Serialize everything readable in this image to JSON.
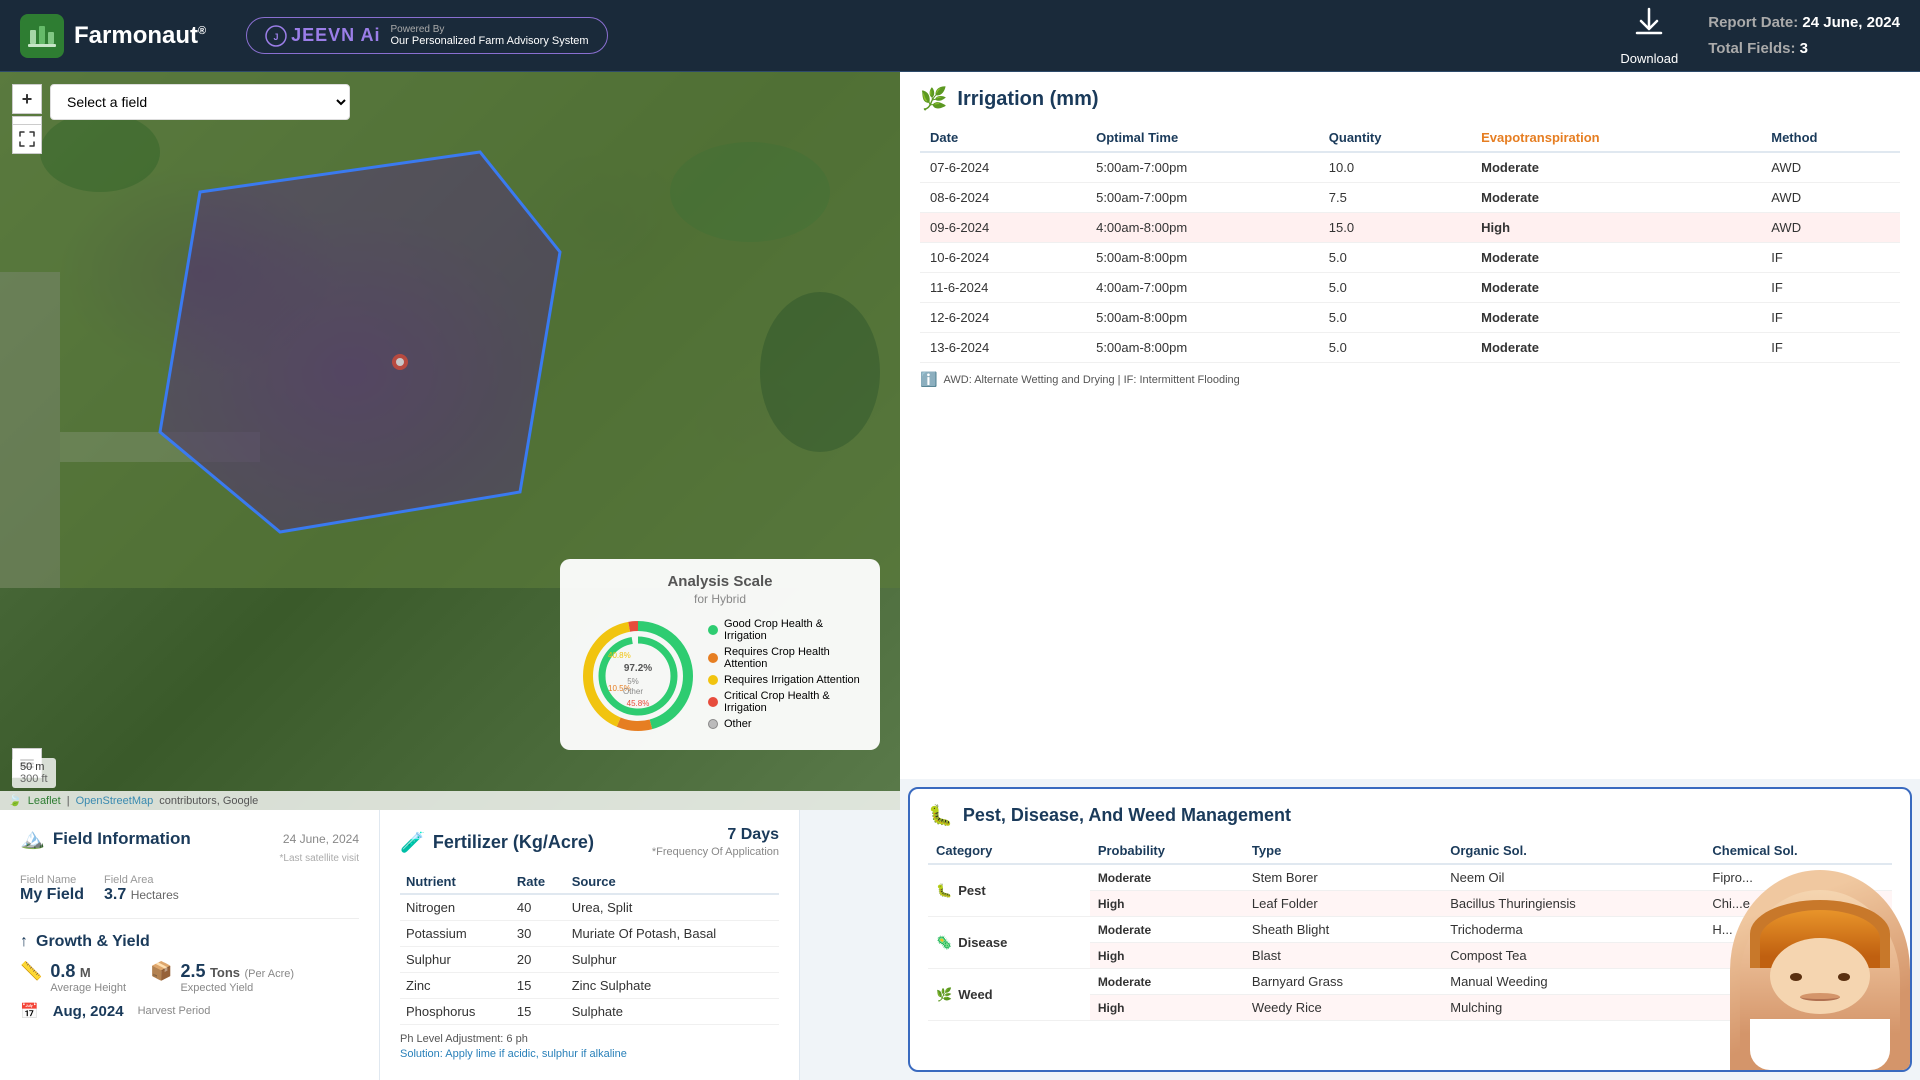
{
  "header": {
    "logo_text": "Farmonaut",
    "logo_reg": "®",
    "jeevn_brand": "JEEVN Ai",
    "jeevn_powered": "Powered By",
    "jeevn_tagline": "Our Personalized Farm Advisory System",
    "download_label": "Download",
    "report_date_label": "Report Date:",
    "report_date": "24 June, 2024",
    "total_fields_label": "Total Fields:",
    "total_fields": "3"
  },
  "map": {
    "field_select_placeholder": "Select a field",
    "zoom_in": "+",
    "zoom_out": "−",
    "scale_50m": "50 m",
    "scale_300ft": "300 ft",
    "attribution_leaflet": "Leaflet",
    "attribution_osm": "OpenStreetMap",
    "attribution_rest": "contributors, Google"
  },
  "analysis_scale": {
    "title": "Analysis Scale",
    "subtitle": "for Hybrid",
    "percent_97": "97.2%",
    "percent_10": "10.5%",
    "percent_45": "45.8%",
    "percent_40": "40.8%",
    "percent_5": "5%",
    "other_label": "Other",
    "legends": [
      {
        "label": "Good Crop Health & Irrigation",
        "color": "#2ecc71"
      },
      {
        "label": "Requires Crop Health Attention",
        "color": "#e67e22"
      },
      {
        "label": "Requires Irrigation Attention",
        "color": "#f1c40f"
      },
      {
        "label": "Critical Crop Health & Irrigation",
        "color": "#e74c3c"
      },
      {
        "label": "Other",
        "color": "#bbb"
      }
    ]
  },
  "field_info": {
    "title": "Field Information",
    "date": "24 June, 2024",
    "last_satellite": "*Last satellite visit",
    "field_name_label": "Field Name",
    "field_name": "My Field",
    "field_area_label": "Field Area",
    "field_area": "3.7",
    "field_area_unit": "Hectares",
    "growth_title": "Growth & Yield",
    "avg_height_label": "Average Height",
    "avg_height_val": "0.8",
    "avg_height_unit": "M",
    "expected_yield_label": "Expected Yield",
    "expected_yield_val": "2.5",
    "expected_yield_unit": "Tons",
    "expected_yield_sub": "(Per Acre)",
    "harvest_label": "Harvest Period",
    "harvest_val": "Aug, 2024"
  },
  "fertilizer": {
    "title": "Fertilizer (Kg/Acre)",
    "freq_label": "7 Days",
    "freq_sub": "*Frequency Of Application",
    "columns": [
      "Nutrient",
      "Rate",
      "Source"
    ],
    "rows": [
      {
        "nutrient": "Nitrogen",
        "rate": "40",
        "source": "Urea, Split"
      },
      {
        "nutrient": "Potassium",
        "rate": "30",
        "source": "Muriate Of Potash, Basal"
      },
      {
        "nutrient": "Sulphur",
        "rate": "20",
        "source": "Sulphur"
      },
      {
        "nutrient": "Zinc",
        "rate": "15",
        "source": "Zinc Sulphate"
      },
      {
        "nutrient": "Phosphorus",
        "rate": "15",
        "source": "Sulphate"
      }
    ],
    "ph_note": "Ph Level Adjustment: 6 ph",
    "solution_note": "Solution: Apply lime if acidic, sulphur if alkaline"
  },
  "irrigation": {
    "title": "Irrigation (mm)",
    "columns": [
      "Date",
      "Optimal Time",
      "Quantity",
      "Evapotranspiration",
      "Method"
    ],
    "rows": [
      {
        "date": "07-6-2024",
        "time": "5:00am-7:00pm",
        "qty": "10.0",
        "evap": "Moderate",
        "method": "AWD",
        "highlight": false
      },
      {
        "date": "08-6-2024",
        "time": "5:00am-7:00pm",
        "qty": "7.5",
        "evap": "Moderate",
        "method": "AWD",
        "highlight": false
      },
      {
        "date": "09-6-2024",
        "time": "4:00am-8:00pm",
        "qty": "15.0",
        "evap": "High",
        "method": "AWD",
        "highlight": true
      },
      {
        "date": "10-6-2024",
        "time": "5:00am-8:00pm",
        "qty": "5.0",
        "evap": "Moderate",
        "method": "IF",
        "highlight": false
      },
      {
        "date": "11-6-2024",
        "time": "4:00am-7:00pm",
        "qty": "5.0",
        "evap": "Moderate",
        "method": "IF",
        "highlight": false
      },
      {
        "date": "12-6-2024",
        "time": "5:00am-8:00pm",
        "qty": "5.0",
        "evap": "Moderate",
        "method": "IF",
        "highlight": false
      },
      {
        "date": "13-6-2024",
        "time": "5:00am-8:00pm",
        "qty": "5.0",
        "evap": "Moderate",
        "method": "IF",
        "highlight": false
      }
    ],
    "footer": "AWD: Alternate Wetting and Drying | IF: Intermittent Flooding"
  },
  "pest": {
    "title": "Pest, Disease, And Weed Management",
    "columns": [
      "Category",
      "Probability",
      "Type",
      "Organic Sol.",
      "Chemical Sol."
    ],
    "pest_rows": [
      {
        "prob": "Moderate",
        "type": "Stem Borer",
        "organic": "Neem Oil",
        "chemical": "Fipro..."
      },
      {
        "prob": "High",
        "type": "Leaf Folder",
        "organic": "Bacillus Thuringiensis",
        "chemical": "Chi...e"
      }
    ],
    "disease_rows": [
      {
        "prob": "Moderate",
        "type": "Sheath Blight",
        "organic": "Trichoderma",
        "chemical": "H..."
      },
      {
        "prob": "High",
        "type": "Blast",
        "organic": "Compost Tea",
        "chemical": ""
      }
    ],
    "weed_rows": [
      {
        "prob": "Moderate",
        "type": "Barnyard Grass",
        "organic": "Manual Weeding",
        "chemical": ""
      },
      {
        "prob": "High",
        "type": "Weedy Rice",
        "organic": "Mulching",
        "chemical": ""
      }
    ]
  }
}
